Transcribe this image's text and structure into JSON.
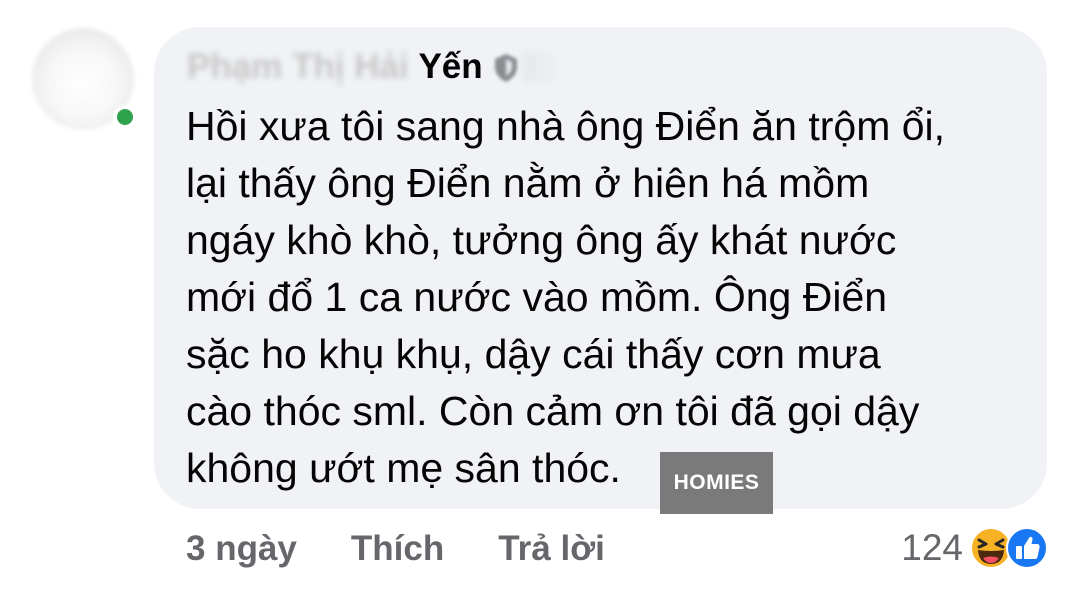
{
  "comment": {
    "author_blurred": "Phạm Thị Hải",
    "author_visible": "Yến",
    "lines": [
      "Hồi xưa tôi sang nhà ông Điển ăn trộm ổi,",
      "lại thấy ông Điển nằm ở hiên há mồm",
      "ngáy khò khò, tưởng ông ấy khát nước",
      "mới đổ 1 ca nước vào mồm. Ông Điển",
      "sặc ho khụ khụ, dậy cái thấy cơn mưa",
      "cào thóc sml. Còn cảm ơn tôi đã gọi dậy",
      "không ướt mẹ sân thóc."
    ],
    "time": "3 ngày",
    "like_label": "Thích",
    "reply_label": "Trả lời",
    "reaction_count": "124",
    "reactions": [
      "haha-icon",
      "like-icon"
    ]
  },
  "watermark": "HOMIES",
  "colors": {
    "bubble": "#f0f2f5",
    "secondary_text": "#65676b",
    "online": "#31a24c",
    "like_blue": "#1877f2",
    "haha_yellow": "#f7b125"
  }
}
